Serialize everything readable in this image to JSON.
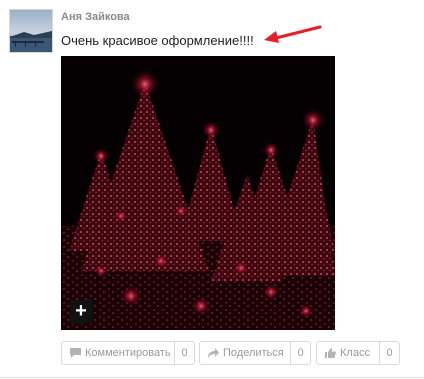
{
  "post": {
    "author_name": "Аня Зайкова",
    "text": "Очень красивое оформление!!!!"
  },
  "photo": {
    "zoom_label": "+"
  },
  "actions": {
    "comment": {
      "label": "Комментировать",
      "count": "0"
    },
    "share": {
      "label": "Поделиться",
      "count": "0"
    },
    "like": {
      "label": "Класс",
      "count": "0"
    }
  },
  "colors": {
    "arrow": "#e5202a",
    "button_text": "#9a9a9a",
    "author": "#8a8a8a"
  }
}
